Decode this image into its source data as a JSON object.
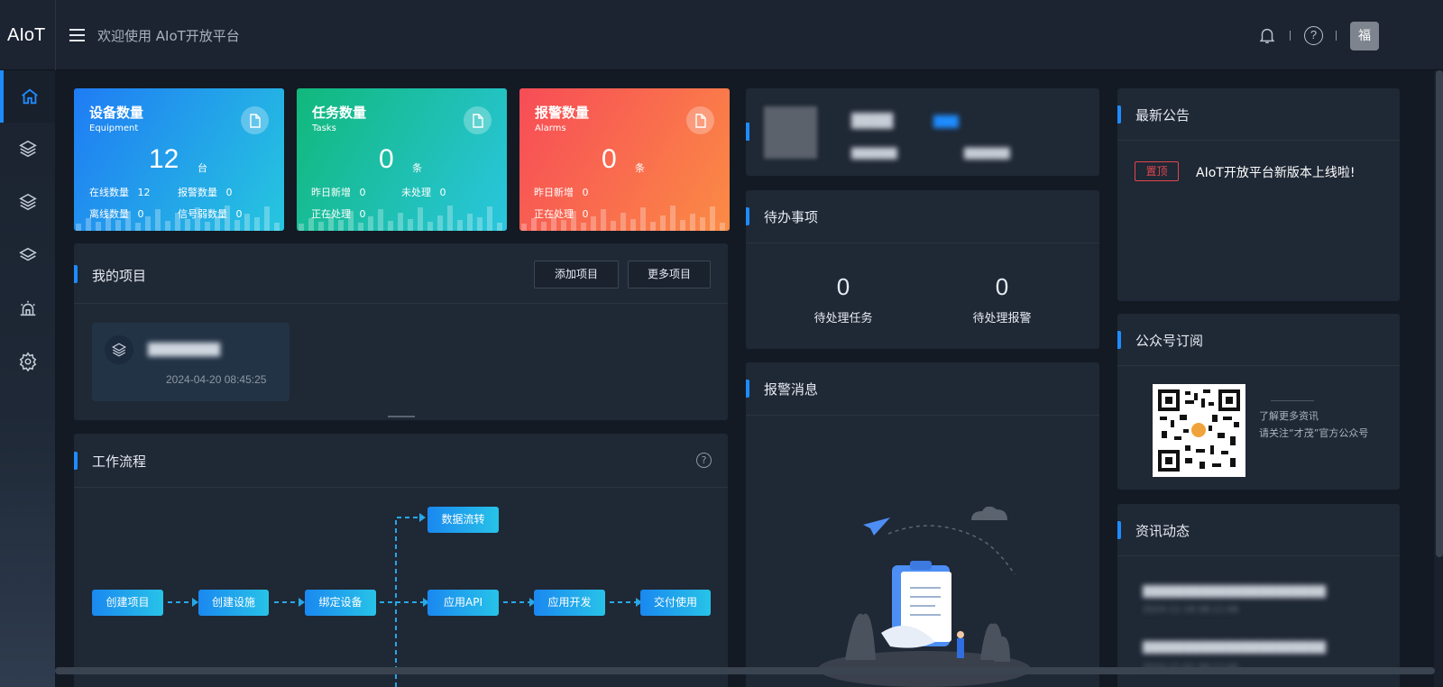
{
  "header": {
    "logo": "AIoT",
    "welcome": "欢迎使用 AIoT开放平台",
    "avatar_text": "福",
    "help_symbol": "?",
    "icons": [
      "menu-icon",
      "bell-icon",
      "help-icon"
    ]
  },
  "sidebar": {
    "items": [
      {
        "name": "home",
        "icon": "home-icon",
        "active": true
      },
      {
        "name": "layers-1",
        "icon": "layers-icon"
      },
      {
        "name": "layers-2",
        "icon": "layers-icon"
      },
      {
        "name": "layers-3",
        "icon": "layers-icon"
      },
      {
        "name": "alarm",
        "icon": "alarm-light-icon"
      },
      {
        "name": "settings",
        "icon": "gear-icon"
      }
    ]
  },
  "stats": {
    "equipment": {
      "title": "设备数量",
      "subtitle": "Equipment",
      "value": "12",
      "unit": "台",
      "l1": "在线数量",
      "v1": "12",
      "l2": "报警数量",
      "v2": "0",
      "l3": "离线数量",
      "v3": "0",
      "l4": "信号弱数量",
      "v4": "0",
      "color_from": "#1f7cf4",
      "color_to": "#26c6df"
    },
    "tasks": {
      "title": "任务数量",
      "subtitle": "Tasks",
      "value": "0",
      "unit": "条",
      "l1": "昨日新增",
      "v1": "0",
      "l2": "未处理",
      "v2": "0",
      "l3": "正在处理",
      "v3": "0",
      "color_from": "#11b87a",
      "color_to": "#2ac6df"
    },
    "alarms": {
      "title": "报警数量",
      "subtitle": "Alarms",
      "value": "0",
      "unit": "条",
      "l1": "昨日新增",
      "v1": "0",
      "l2": "正在处理",
      "v2": "0",
      "color_from": "#f74c57",
      "color_to": "#fb8b45"
    }
  },
  "projects": {
    "title": "我的项目",
    "add_label": "添加项目",
    "more_label": "更多项目",
    "items": [
      {
        "name": "████████",
        "date": "2024-04-20 08:45:25"
      }
    ]
  },
  "workflow": {
    "title": "工作流程",
    "steps": [
      "创建项目",
      "创建设施",
      "绑定设备",
      "应用API",
      "应用开发",
      "交付使用"
    ],
    "branch_top": "数据流转",
    "help_symbol": "?"
  },
  "profile": {
    "name_blurred": "████",
    "tag_blurred": "███",
    "info1_blurred": "██████",
    "info2_blurred": "██████"
  },
  "todo": {
    "title": "待办事项",
    "tasks_value": "0",
    "tasks_label": "待处理任务",
    "alarms_value": "0",
    "alarms_label": "待处理报警"
  },
  "alarm_messages": {
    "title": "报警消息"
  },
  "notice": {
    "title": "最新公告",
    "tag": "置顶",
    "text": "AIoT开放平台新版本上线啦!"
  },
  "subscribe": {
    "title": "公众号订阅",
    "line1": "了解更多资讯",
    "line2": "请关注“才茂”官方公众号"
  },
  "news": {
    "title": "资讯动态",
    "items": [
      {
        "title": "██████████████████████",
        "date": "2024-11-18 08:11:06"
      },
      {
        "title": "██████████████████████",
        "date": "2024-11-01 09:12:00"
      }
    ]
  }
}
